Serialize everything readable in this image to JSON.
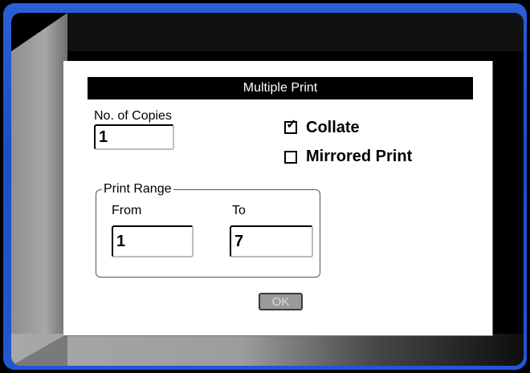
{
  "dialog": {
    "title": "Multiple Print",
    "copies": {
      "label": "No. of Copies",
      "value": "1"
    },
    "collate": {
      "label": "Collate",
      "checked": true,
      "mark": "✓"
    },
    "mirrored": {
      "label": "Mirrored Print",
      "checked": false
    },
    "print_range": {
      "legend": "Print Range",
      "from_label": "From",
      "from_value": "1",
      "to_label": "To",
      "to_value": "7"
    },
    "ok_label": "OK"
  },
  "colors": {
    "screen_border": "#1b4dc7",
    "title_bar": "#000000",
    "ok_button_bg": "#9a9a9a"
  }
}
